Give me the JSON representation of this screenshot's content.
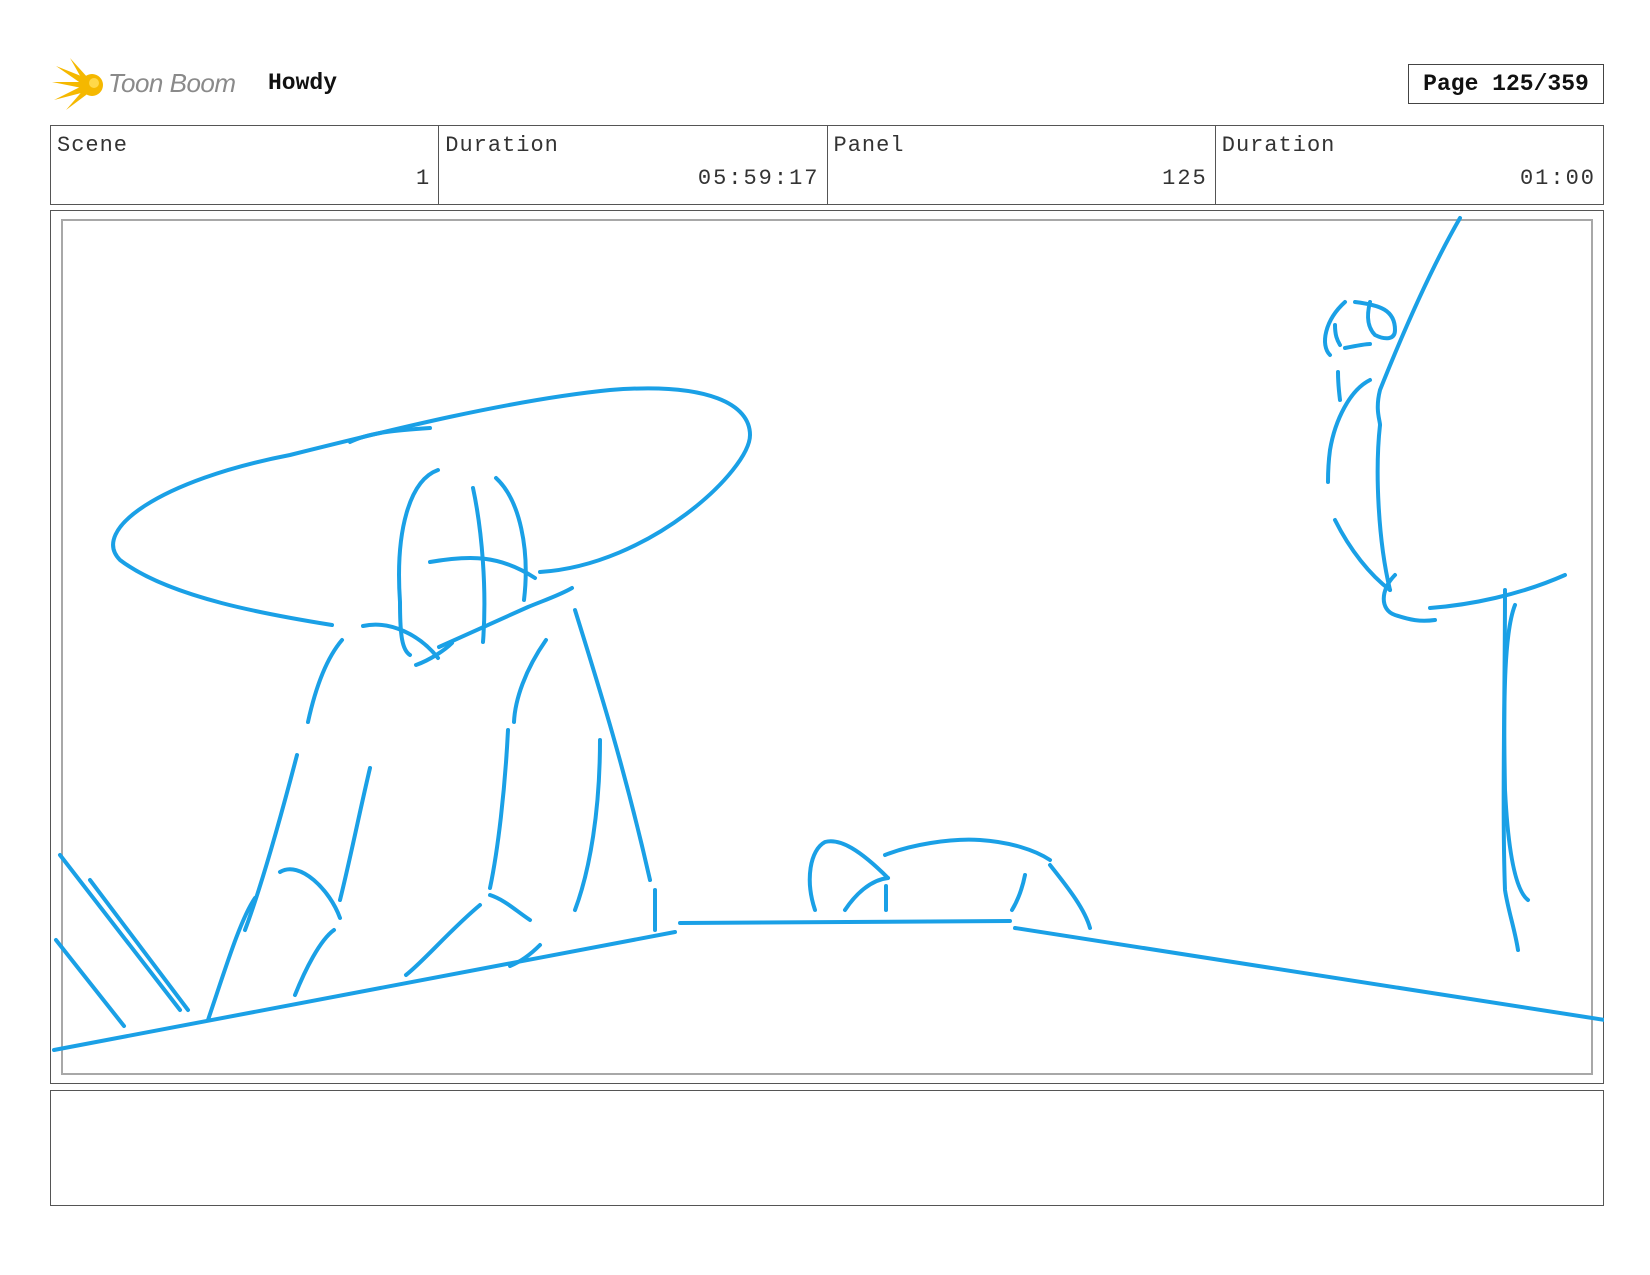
{
  "header": {
    "logo_text": "Toon Boom",
    "project_title": "Howdy",
    "page_label": "Page 125/359"
  },
  "info": [
    {
      "label": "Scene",
      "value": "1"
    },
    {
      "label": "Duration",
      "value": "05:59:17"
    },
    {
      "label": "Panel",
      "value": "125"
    },
    {
      "label": "Duration",
      "value": "01:00"
    }
  ],
  "colors": {
    "sketch_stroke": "#1aa0e6",
    "logo_star": "#f5b800",
    "logo_text": "#8a8a8a"
  },
  "notes": ""
}
